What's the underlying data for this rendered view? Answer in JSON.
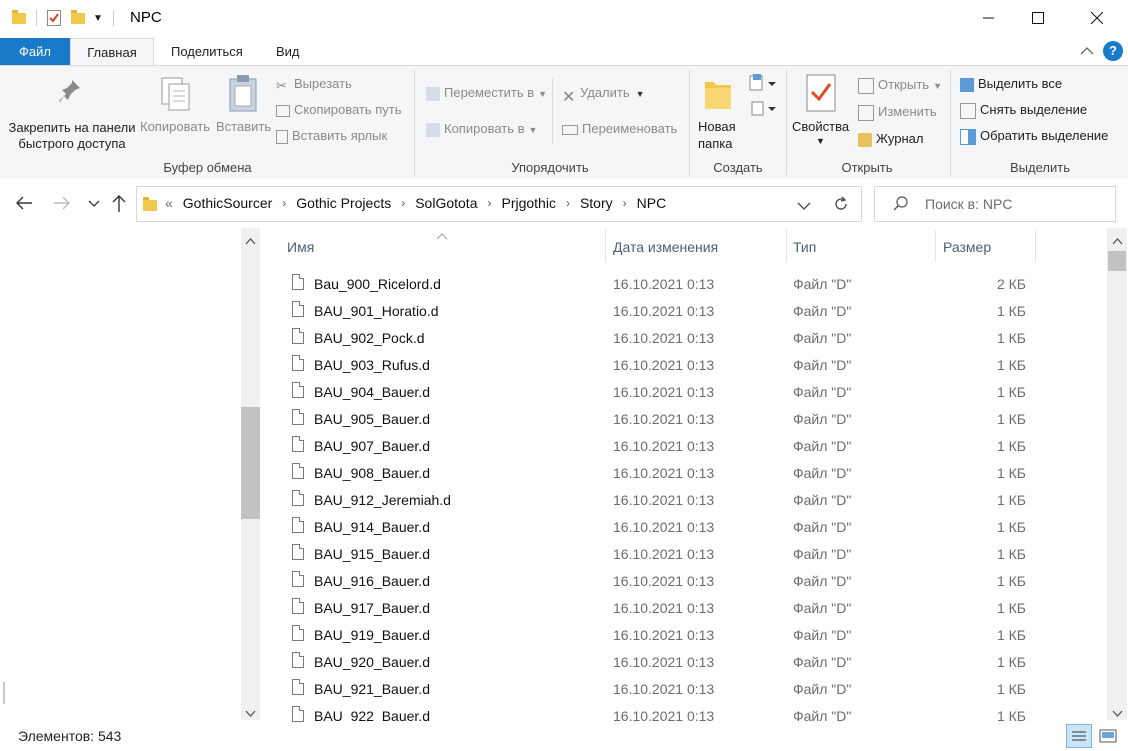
{
  "window": {
    "title": "NPC"
  },
  "tabs": {
    "file": "Файл",
    "home": "Главная",
    "share": "Поделиться",
    "view": "Вид"
  },
  "ribbon": {
    "clipboard": {
      "pin": "Закрепить на панели быстрого доступа",
      "pin_line1": "Закрепить на панели",
      "pin_line2": "быстрого доступа",
      "copy": "Копировать",
      "paste": "Вставить",
      "cut": "Вырезать",
      "copy_path": "Скопировать путь",
      "paste_shortcut": "Вставить ярлык",
      "label": "Буфер обмена"
    },
    "organize": {
      "move_to": "Переместить в",
      "copy_to": "Копировать в",
      "delete": "Удалить",
      "rename": "Переименовать",
      "label": "Упорядочить"
    },
    "create": {
      "new_folder_line1": "Новая",
      "new_folder_line2": "папка",
      "label": "Создать"
    },
    "open": {
      "properties": "Свойства",
      "open": "Открыть",
      "edit": "Изменить",
      "history": "Журнал",
      "label": "Открыть"
    },
    "select": {
      "select_all": "Выделить все",
      "select_none": "Снять выделение",
      "invert": "Обратить выделение",
      "label": "Выделить"
    }
  },
  "address": {
    "prefix": "«",
    "crumbs": [
      "GothicSourcer",
      "Gothic Projects",
      "SolGotota",
      "Prjgothic",
      "Story",
      "NPC"
    ],
    "search_placeholder": "Поиск в: NPC"
  },
  "columns": {
    "name": "Имя",
    "date": "Дата изменения",
    "type": "Тип",
    "size": "Размер"
  },
  "files": [
    {
      "name": "Bau_900_Ricelord.d",
      "date": "16.10.2021 0:13",
      "type": "Файл \"D\"",
      "size": "2 КБ"
    },
    {
      "name": "BAU_901_Horatio.d",
      "date": "16.10.2021 0:13",
      "type": "Файл \"D\"",
      "size": "1 КБ"
    },
    {
      "name": "BAU_902_Pock.d",
      "date": "16.10.2021 0:13",
      "type": "Файл \"D\"",
      "size": "1 КБ"
    },
    {
      "name": "BAU_903_Rufus.d",
      "date": "16.10.2021 0:13",
      "type": "Файл \"D\"",
      "size": "1 КБ"
    },
    {
      "name": "BAU_904_Bauer.d",
      "date": "16.10.2021 0:13",
      "type": "Файл \"D\"",
      "size": "1 КБ"
    },
    {
      "name": "BAU_905_Bauer.d",
      "date": "16.10.2021 0:13",
      "type": "Файл \"D\"",
      "size": "1 КБ"
    },
    {
      "name": "BAU_907_Bauer.d",
      "date": "16.10.2021 0:13",
      "type": "Файл \"D\"",
      "size": "1 КБ"
    },
    {
      "name": "BAU_908_Bauer.d",
      "date": "16.10.2021 0:13",
      "type": "Файл \"D\"",
      "size": "1 КБ"
    },
    {
      "name": "BAU_912_Jeremiah.d",
      "date": "16.10.2021 0:13",
      "type": "Файл \"D\"",
      "size": "1 КБ"
    },
    {
      "name": "BAU_914_Bauer.d",
      "date": "16.10.2021 0:13",
      "type": "Файл \"D\"",
      "size": "1 КБ"
    },
    {
      "name": "BAU_915_Bauer.d",
      "date": "16.10.2021 0:13",
      "type": "Файл \"D\"",
      "size": "1 КБ"
    },
    {
      "name": "BAU_916_Bauer.d",
      "date": "16.10.2021 0:13",
      "type": "Файл \"D\"",
      "size": "1 КБ"
    },
    {
      "name": "BAU_917_Bauer.d",
      "date": "16.10.2021 0:13",
      "type": "Файл \"D\"",
      "size": "1 КБ"
    },
    {
      "name": "BAU_919_Bauer.d",
      "date": "16.10.2021 0:13",
      "type": "Файл \"D\"",
      "size": "1 КБ"
    },
    {
      "name": "BAU_920_Bauer.d",
      "date": "16.10.2021 0:13",
      "type": "Файл \"D\"",
      "size": "1 КБ"
    },
    {
      "name": "BAU_921_Bauer.d",
      "date": "16.10.2021 0:13",
      "type": "Файл \"D\"",
      "size": "1 КБ"
    },
    {
      "name": "BAU_922_Bauer.d",
      "date": "16.10.2021 0:13",
      "type": "Файл \"D\"",
      "size": "1 КБ"
    }
  ],
  "status": {
    "items": "Элементов: 543"
  },
  "colors": {
    "accent": "#1979ca",
    "ribbon_bg": "#f5f6f7"
  }
}
